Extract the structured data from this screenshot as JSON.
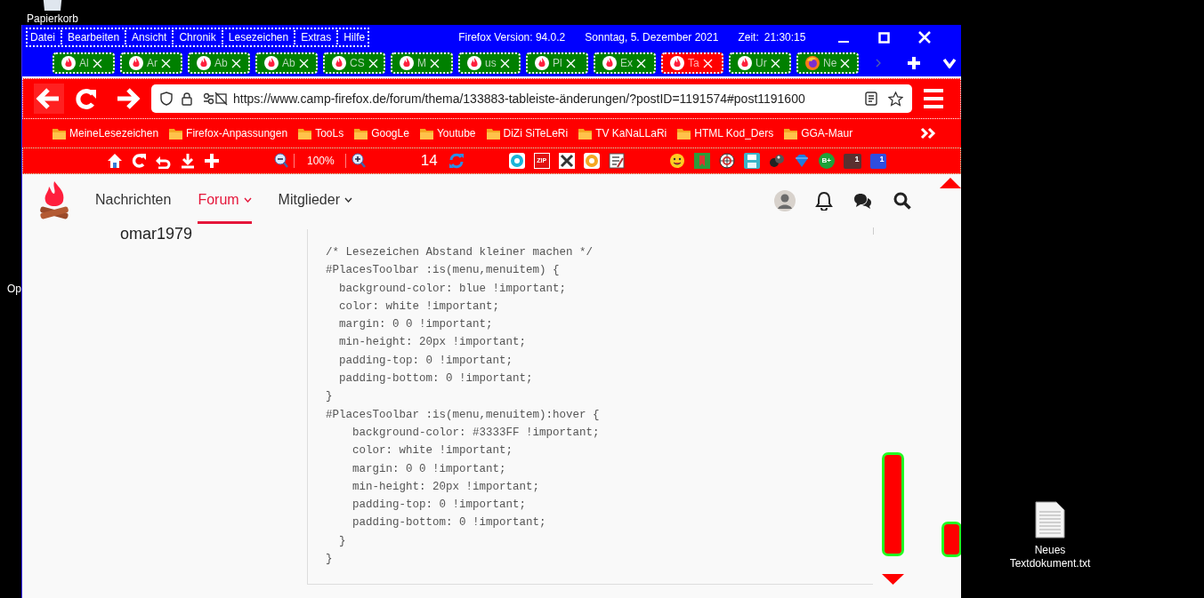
{
  "desktop": {
    "icons": [
      {
        "label": "Papierkorb",
        "kind": "bin"
      },
      {
        "label": "Op",
        "kind": "cut"
      },
      {
        "label": "Neues Textdokument.txt",
        "kind": "file"
      }
    ]
  },
  "menu": [
    {
      "label": "Datei"
    },
    {
      "label": "Bearbeiten"
    },
    {
      "label": "Ansicht"
    },
    {
      "label": "Chronik"
    },
    {
      "label": "Lesezeichen"
    },
    {
      "label": "Extras"
    },
    {
      "label": "Hilfe"
    }
  ],
  "title_info": [
    "Firefox Version: 94.0.2",
    "Sonntag, 5. Dezember 2021",
    "Zeit:",
    "21:30:15"
  ],
  "tabs": [
    {
      "label": "Al",
      "selected": false,
      "kind": "forum"
    },
    {
      "label": "Ar",
      "selected": false,
      "kind": "forum"
    },
    {
      "label": "Ab",
      "selected": false,
      "kind": "forum"
    },
    {
      "label": "Ab",
      "selected": false,
      "kind": "forum"
    },
    {
      "label": "CS",
      "selected": false,
      "kind": "forum"
    },
    {
      "label": "M",
      "selected": false,
      "kind": "forum"
    },
    {
      "label": "us",
      "selected": false,
      "kind": "forum"
    },
    {
      "label": "Pl",
      "selected": false,
      "kind": "forum"
    },
    {
      "label": "Ex",
      "selected": false,
      "kind": "forum"
    },
    {
      "label": "Ta",
      "selected": true,
      "kind": "forum"
    },
    {
      "label": "Ur",
      "selected": false,
      "kind": "forum"
    },
    {
      "label": "Ne",
      "selected": false,
      "kind": "firefox"
    }
  ],
  "url": "https://www.camp-firefox.de/forum/thema/133883-tableiste-änderungen/?postID=1191574#post1191600",
  "bookmarks": [
    "MeineLesezeichen",
    "Firefox-Anpassungen",
    "TooLs",
    "GoogLe",
    "Youtube",
    "DiZi SiTeLeRi",
    "TV KaNaLLaRi",
    "HTML Kod_Ders",
    "GGA-Maur"
  ],
  "toolbar": {
    "zoom": "100%",
    "counter": "14",
    "badges": [
      "ZIP",
      "B+",
      "1",
      "1"
    ]
  },
  "site_nav": [
    {
      "label": "Nachrichten",
      "selected": false,
      "dropdown": false
    },
    {
      "label": "Forum",
      "selected": true,
      "dropdown": true
    },
    {
      "label": "Mitglieder",
      "selected": false,
      "dropdown": true
    }
  ],
  "post_author": "omar1979",
  "code": [
    "/* Lesezeichen Abstand kleiner machen */",
    "#PlacesToolbar :is(menu,menuitem) {",
    "  background-color: blue !important;",
    "  color: white !important;",
    "  margin: 0 0 !important;",
    "  min-height: 20px !important;",
    "  padding-top: 0 !important;",
    "  padding-bottom: 0 !important;",
    "}",
    "#PlacesToolbar :is(menu,menuitem):hover {",
    "    background-color: #3333FF !important;",
    "    color: white !important;",
    "    margin: 0 0 !important;",
    "    min-height: 20px !important;",
    "    padding-top: 0 !important;",
    "    padding-bottom: 0 !important;",
    "  }",
    "}"
  ]
}
